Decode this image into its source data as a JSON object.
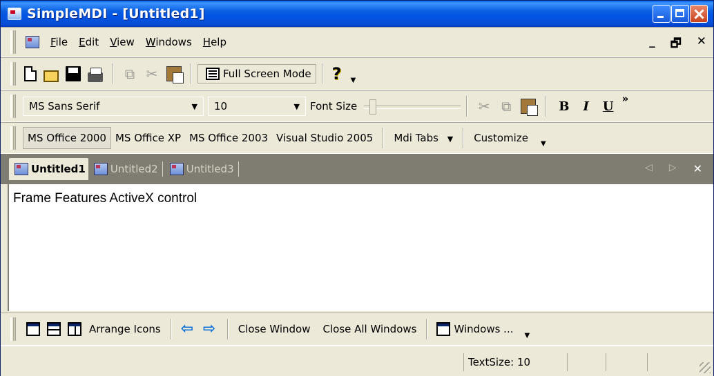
{
  "window": {
    "title": "SimpleMDI - [Untitled1]"
  },
  "menubar": {
    "items": [
      {
        "label": "File",
        "accel_index": 0
      },
      {
        "label": "Edit",
        "accel_index": 0
      },
      {
        "label": "View",
        "accel_index": 0
      },
      {
        "label": "Windows",
        "accel_index": 0
      },
      {
        "label": "Help",
        "accel_index": 0
      }
    ],
    "mdi_controls": [
      "_",
      "🗗",
      "✕"
    ]
  },
  "toolbar_standard": {
    "icons": [
      "new-icon",
      "open-icon",
      "save-icon",
      "print-icon",
      "copy-icon",
      "cut-icon",
      "paste-icon",
      "full-screen-icon",
      "help-icon"
    ],
    "full_screen_label": "Full Screen Mode"
  },
  "toolbar_format": {
    "font_name": "MS Sans Serif",
    "font_size": "10",
    "font_size_label": "Font Size",
    "bold": "B",
    "italic": "I",
    "underline": "U"
  },
  "toolbar_styles": {
    "items": [
      "MS Office 2000",
      "MS Office XP",
      "MS Office 2003",
      "Visual Studio 2005"
    ],
    "active": "MS Office 2000",
    "mdi_tabs_label": "Mdi Tabs",
    "customize_label": "Customize"
  },
  "tabs": [
    {
      "label": "Untitled1",
      "active": true
    },
    {
      "label": "Untitled2",
      "active": false
    },
    {
      "label": "Untitled3",
      "active": false
    }
  ],
  "content": {
    "text": "Frame Features ActiveX control"
  },
  "toolbar_window": {
    "arrange_label": "Arrange Icons",
    "close_window_label": "Close Window",
    "close_all_label": "Close All Windows",
    "windows_label": "Windows ..."
  },
  "statusbar": {
    "text_size": "TextSize: 10"
  }
}
